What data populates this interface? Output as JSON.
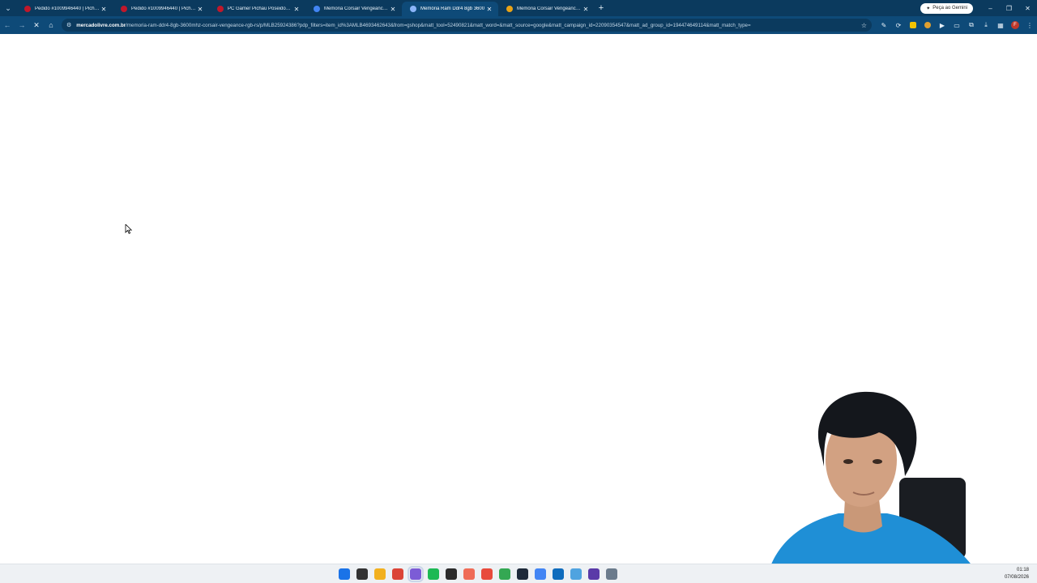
{
  "browser": {
    "tabs": [
      {
        "title": "Pedido #1009946440 | Pichau",
        "favicon_color": "#c0182b",
        "active": false
      },
      {
        "title": "Pedido #1009946440 | Pichau",
        "favicon_color": "#c0182b",
        "active": false
      },
      {
        "title": "PC Gamer Pichau Poseidon III,",
        "favicon_color": "#c0182b",
        "active": false
      },
      {
        "title": "Memoria Corsair Vengeance R",
        "favicon_color": "#4285f4",
        "active": false
      },
      {
        "title": "Memória Ram Ddr4 8gb 3600",
        "favicon_color": "#8ab4f8",
        "active": true
      },
      {
        "title": "Memória Corsair Vengeance R",
        "favicon_color": "#e8a317",
        "active": false
      }
    ],
    "new_tab": "+",
    "gemini_label": "Peça ao Gemini",
    "window_controls": {
      "minimize": "–",
      "restore": "❐",
      "close": "✕"
    },
    "url_host": "mercadolivre.com.br",
    "url_path": "/memoria-ram-ddr4-8gb-3600mhz-corsair-vengeance-rgb-rs/p/MLB25924386?pdp_filters=item_id%3AMLB4693462643&from=gshop&matt_tool=52490821&matt_word=&matt_source=google&matt_campaign_id=22090354547&matt_ad_group_id=194474649114&matt_match_type=",
    "profile_initial": "F"
  },
  "colors": {
    "tab_strip": "#0b3a5e",
    "toolbar": "#0e4a78",
    "page_bg": "#ffffff",
    "taskbar": "#eef1f4"
  },
  "taskbar": {
    "icons": [
      {
        "name": "windows-start-icon",
        "color": "#1a73e8"
      },
      {
        "name": "task-view-icon",
        "color": "#333333"
      },
      {
        "name": "file-explorer-icon",
        "color": "#f2b01e"
      },
      {
        "name": "chrome-icon",
        "color": "#db4437"
      },
      {
        "name": "chrome-dev-icon",
        "color": "#7c5cd6"
      },
      {
        "name": "spotify-icon",
        "color": "#1db954"
      },
      {
        "name": "terminal-icon",
        "color": "#2b2b2b"
      },
      {
        "name": "notes-icon",
        "color": "#ef6c57"
      },
      {
        "name": "app-icon",
        "color": "#e84a3c"
      },
      {
        "name": "chrome-beta-icon",
        "color": "#34a853"
      },
      {
        "name": "dark-app-icon",
        "color": "#1e2a3a"
      },
      {
        "name": "chrome-canary-icon",
        "color": "#4285f4"
      },
      {
        "name": "outlook-icon",
        "color": "#0f6cbd"
      },
      {
        "name": "document-icon",
        "color": "#4fa3e0"
      },
      {
        "name": "obs-icon",
        "color": "#5a3aa8"
      },
      {
        "name": "settings-icon",
        "color": "#6b7b8c"
      }
    ],
    "time": "01:18",
    "date": "07/08/2026"
  }
}
